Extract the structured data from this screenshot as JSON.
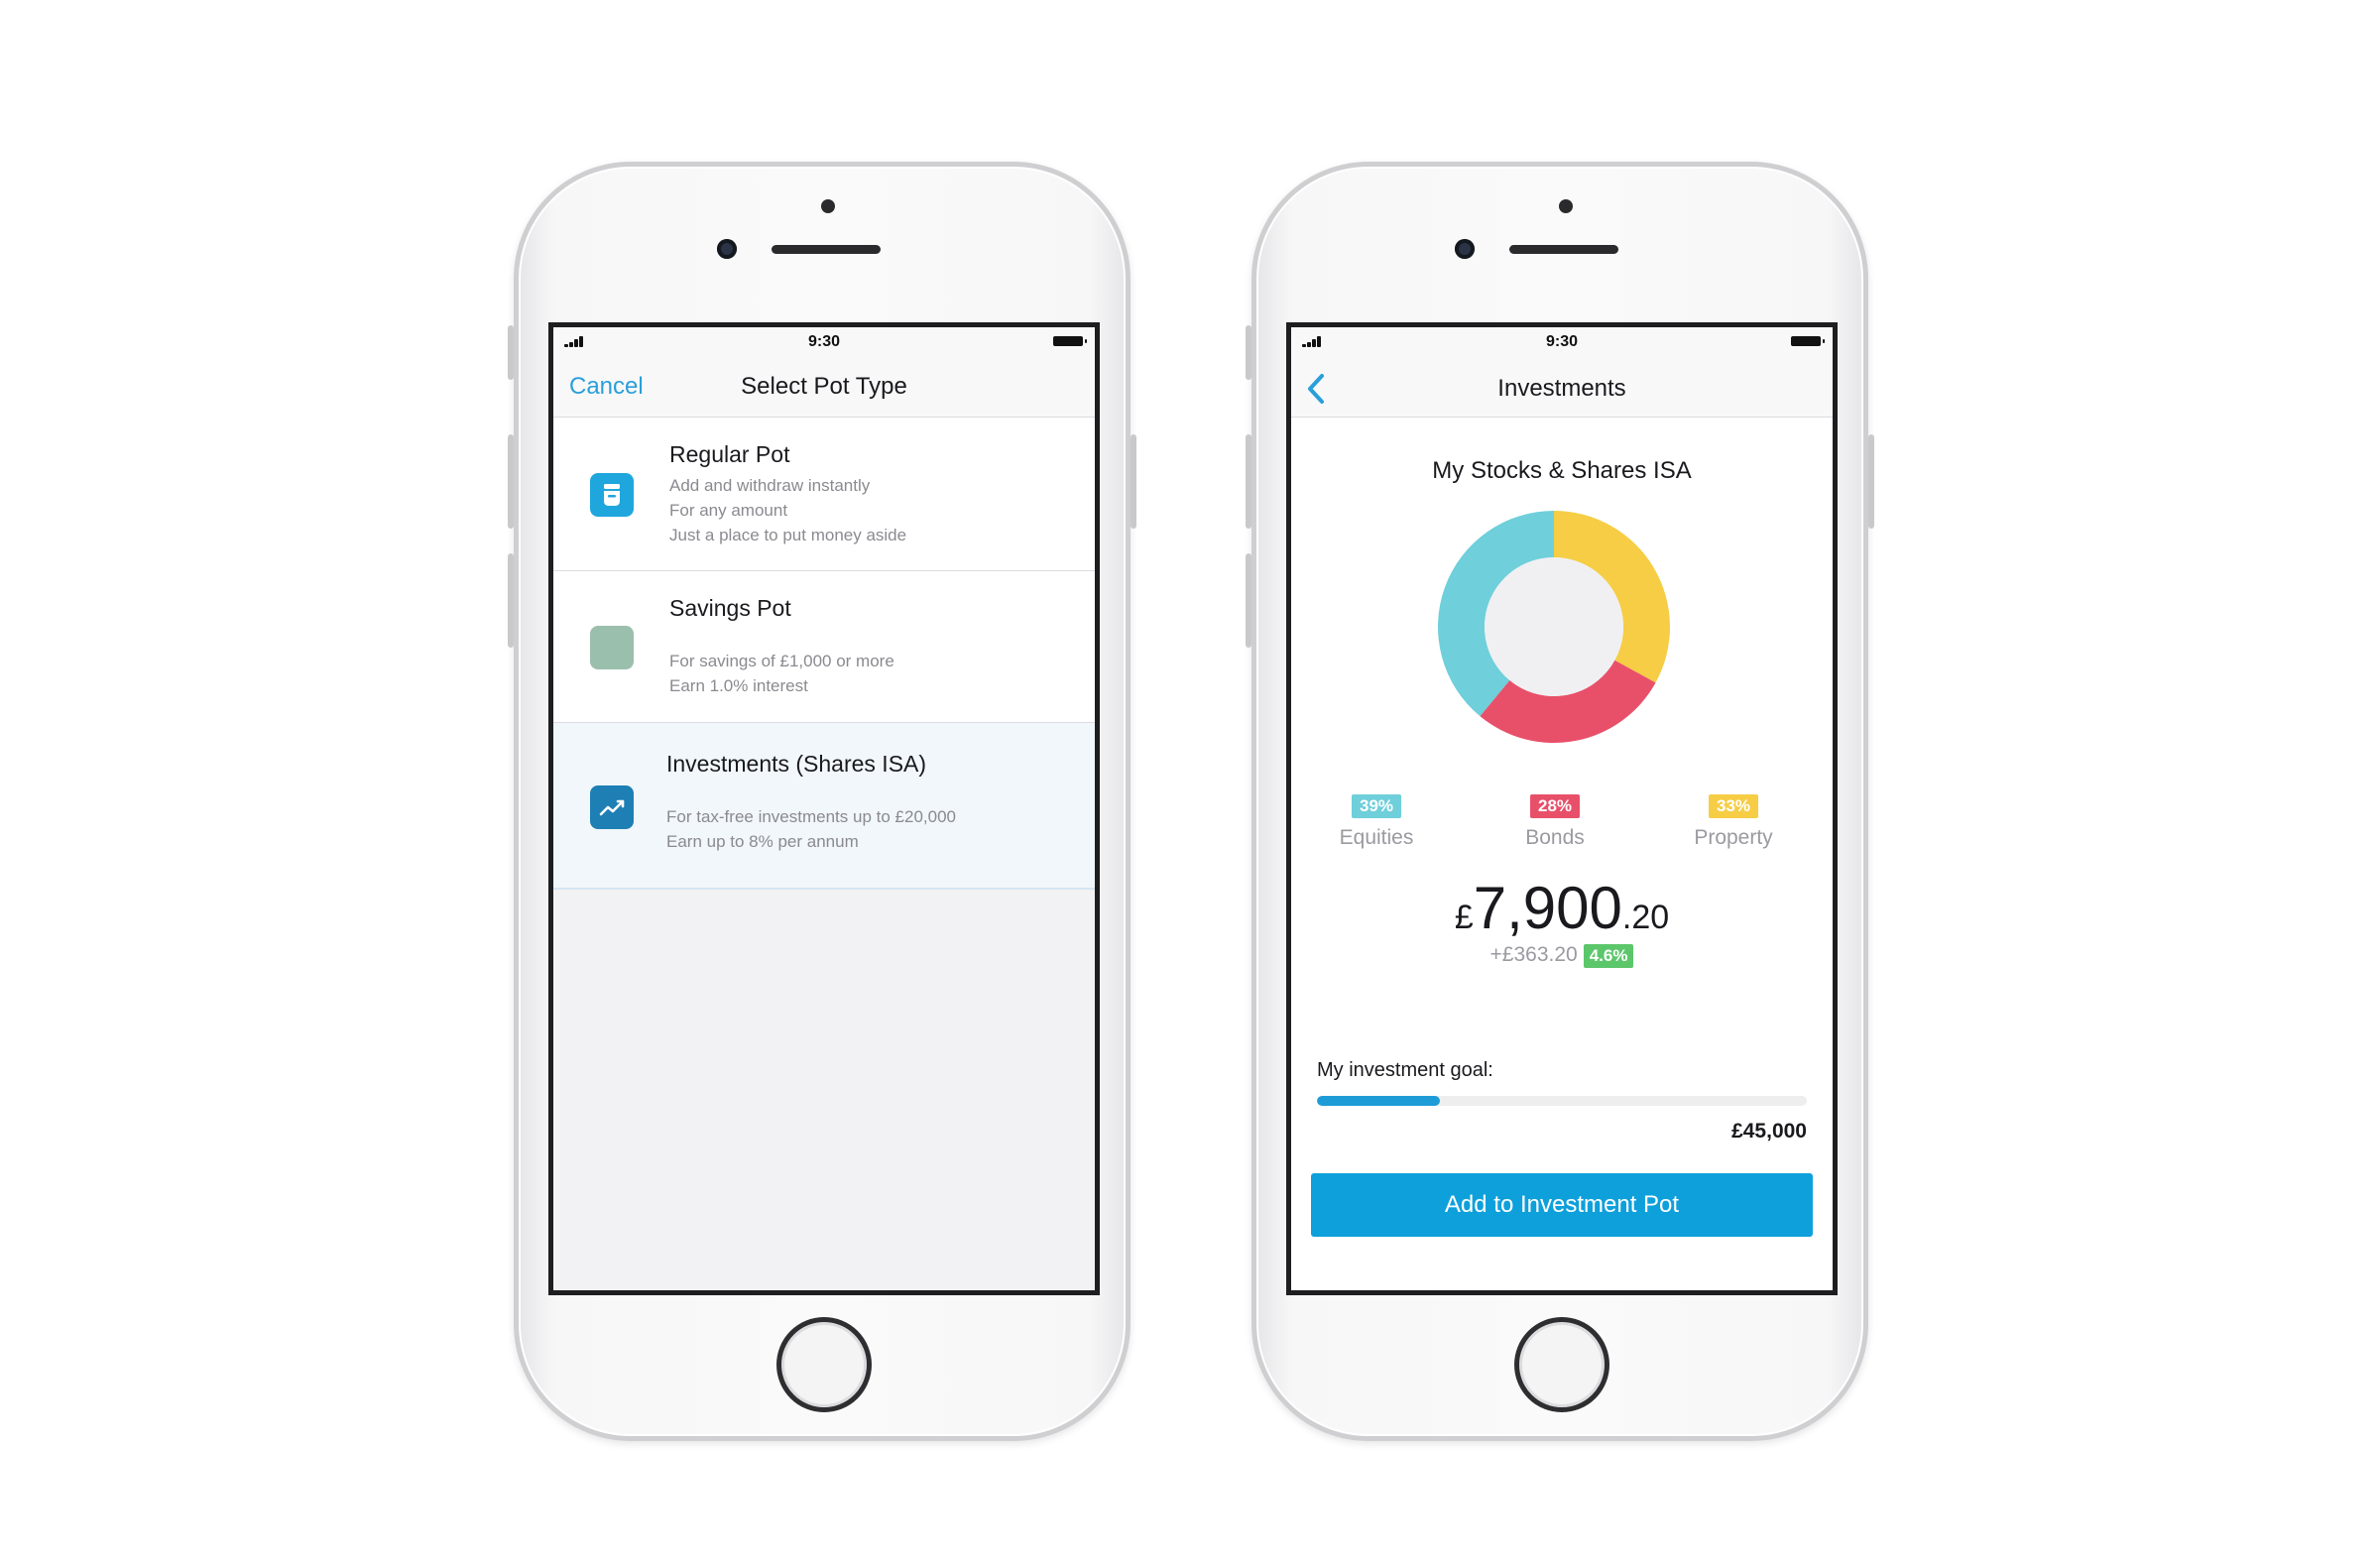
{
  "colors": {
    "accent": "#0ea0db",
    "nav_link": "#2a9fd8",
    "regular_pot": "#1fa6dd",
    "savings_pot": "#9bbfad",
    "investment_pot": "#1d7fb4",
    "equities": "#6fcfdb",
    "bonds": "#e8506a",
    "property": "#f6cd45",
    "gain_badge": "#5cc66b"
  },
  "left_screen": {
    "status": {
      "time": "9:30"
    },
    "nav": {
      "left_label": "Cancel",
      "title": "Select Pot Type"
    },
    "pots": [
      {
        "title": "Regular Pot",
        "icon": "pot-icon",
        "lines": [
          "Add and withdraw instantly",
          "For any amount",
          "Just a place to put money aside"
        ]
      },
      {
        "title": "Savings Pot",
        "icon": "savings-icon",
        "lines": [
          "For savings of £1,000 or more",
          "Earn 1.0% interest"
        ]
      },
      {
        "title": "Investments (Shares ISA)",
        "icon": "trend-up-icon",
        "lines": [
          "For tax-free investments up to £20,000",
          "Earn up to 8% per annum"
        ]
      }
    ]
  },
  "right_screen": {
    "status": {
      "time": "9:30"
    },
    "nav": {
      "back_icon": "chevron-left-icon",
      "title": "Investments"
    },
    "card_title": "My Stocks & Shares ISA",
    "allocation": [
      {
        "label": "Equities",
        "percent_text": "39%",
        "percent": 39,
        "color": "#6fcfdb"
      },
      {
        "label": "Bonds",
        "percent_text": "28%",
        "percent": 28,
        "color": "#e8506a"
      },
      {
        "label": "Property",
        "percent_text": "33%",
        "percent": 33,
        "color": "#f6cd45"
      }
    ],
    "balance": {
      "currency": "£",
      "whole": "7,900",
      "pence": ".20"
    },
    "change": {
      "amount": "+£363.20",
      "percent": "4.6%"
    },
    "goal": {
      "label": "My investment goal:",
      "amount": "£45,000",
      "progress": 0.25
    },
    "cta_label": "Add to Investment Pot"
  }
}
